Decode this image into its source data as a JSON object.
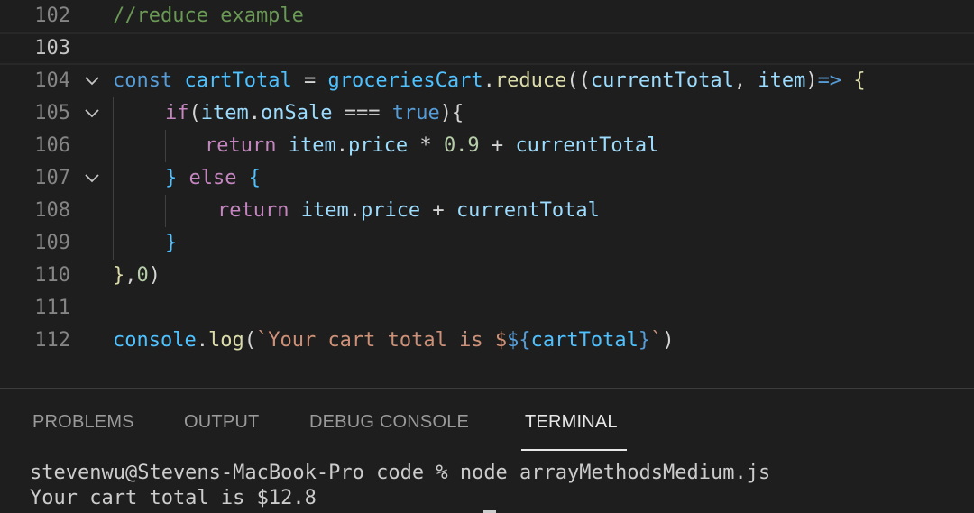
{
  "editor": {
    "lines": [
      {
        "num": "102",
        "fold": false,
        "tokens": [
          {
            "c": "tk-comment",
            "t": "//reduce example"
          }
        ]
      },
      {
        "num": "103",
        "fold": false,
        "current": true,
        "tokens": []
      },
      {
        "num": "104",
        "fold": true,
        "tokens": [
          {
            "c": "tk-keyword",
            "t": "const "
          },
          {
            "c": "tk-var",
            "t": "cartTotal"
          },
          {
            "c": "tk-plain",
            "t": " = "
          },
          {
            "c": "tk-var",
            "t": "groceriesCart"
          },
          {
            "c": "tk-plain",
            "t": "."
          },
          {
            "c": "tk-fn",
            "t": "reduce"
          },
          {
            "c": "tk-plain",
            "t": "(("
          },
          {
            "c": "tk-prop",
            "t": "currentTotal"
          },
          {
            "c": "tk-plain",
            "t": ", "
          },
          {
            "c": "tk-prop",
            "t": "item"
          },
          {
            "c": "tk-plain",
            "t": ")"
          },
          {
            "c": "tk-keyword",
            "t": "=>"
          },
          {
            "c": "tk-plain",
            "t": " "
          },
          {
            "c": "tk-fn",
            "t": "{"
          }
        ]
      },
      {
        "num": "105",
        "fold": true,
        "indent": 58,
        "tokens": [
          {
            "c": "tk-keyword2",
            "t": "if"
          },
          {
            "c": "tk-plain",
            "t": "("
          },
          {
            "c": "tk-prop",
            "t": "item"
          },
          {
            "c": "tk-plain",
            "t": "."
          },
          {
            "c": "tk-prop",
            "t": "onSale"
          },
          {
            "c": "tk-plain",
            "t": " === "
          },
          {
            "c": "tk-keyword",
            "t": "true"
          },
          {
            "c": "tk-plain",
            "t": "){"
          }
        ]
      },
      {
        "num": "106",
        "fold": false,
        "indent": 102,
        "tokens": [
          {
            "c": "tk-keyword2",
            "t": "return "
          },
          {
            "c": "tk-prop",
            "t": "item"
          },
          {
            "c": "tk-plain",
            "t": "."
          },
          {
            "c": "tk-prop",
            "t": "price"
          },
          {
            "c": "tk-plain",
            "t": " * "
          },
          {
            "c": "tk-num",
            "t": "0.9"
          },
          {
            "c": "tk-plain",
            "t": " + "
          },
          {
            "c": "tk-prop",
            "t": "currentTotal"
          }
        ]
      },
      {
        "num": "107",
        "fold": true,
        "indent": 58,
        "tokens": [
          {
            "c": "tk-var",
            "t": "}"
          },
          {
            "c": "tk-keyword2",
            "t": " else "
          },
          {
            "c": "tk-var",
            "t": "{"
          }
        ]
      },
      {
        "num": "108",
        "fold": false,
        "indent": 116,
        "tokens": [
          {
            "c": "tk-keyword2",
            "t": "return "
          },
          {
            "c": "tk-prop",
            "t": "item"
          },
          {
            "c": "tk-plain",
            "t": "."
          },
          {
            "c": "tk-prop",
            "t": "price"
          },
          {
            "c": "tk-plain",
            "t": " + "
          },
          {
            "c": "tk-prop",
            "t": "currentTotal"
          }
        ]
      },
      {
        "num": "109",
        "fold": false,
        "indent": 58,
        "tokens": [
          {
            "c": "tk-var",
            "t": "}"
          }
        ]
      },
      {
        "num": "110",
        "fold": false,
        "tokens": [
          {
            "c": "tk-fn",
            "t": "}"
          },
          {
            "c": "tk-plain",
            "t": ","
          },
          {
            "c": "tk-num",
            "t": "0"
          },
          {
            "c": "tk-plain",
            "t": ")"
          }
        ]
      },
      {
        "num": "111",
        "fold": false,
        "tokens": []
      },
      {
        "num": "112",
        "fold": false,
        "tokens": [
          {
            "c": "tk-var",
            "t": "console"
          },
          {
            "c": "tk-plain",
            "t": "."
          },
          {
            "c": "tk-fn",
            "t": "log"
          },
          {
            "c": "tk-plain",
            "t": "("
          },
          {
            "c": "tk-str",
            "t": "`Your cart total is $"
          },
          {
            "c": "tk-keyword",
            "t": "${"
          },
          {
            "c": "tk-var",
            "t": "cartTotal"
          },
          {
            "c": "tk-keyword",
            "t": "}"
          },
          {
            "c": "tk-str",
            "t": "`"
          },
          {
            "c": "tk-plain",
            "t": ")"
          }
        ]
      }
    ]
  },
  "panel": {
    "tabs": [
      {
        "label": "PROBLEMS",
        "active": false
      },
      {
        "label": "OUTPUT",
        "active": false
      },
      {
        "label": "DEBUG CONSOLE",
        "active": false
      },
      {
        "label": "TERMINAL",
        "active": true
      }
    ],
    "terminal": {
      "command_line": "stevenwu@Stevens-MacBook-Pro code % node arrayMethodsMedium.js",
      "output_line": "Your cart total is $12.8"
    }
  },
  "icons": {
    "fold": "chevron-down-icon"
  },
  "colors": {
    "background": "#1e1e1e",
    "line_number": "#858585",
    "fold_chevron": "#c5c5c5"
  }
}
